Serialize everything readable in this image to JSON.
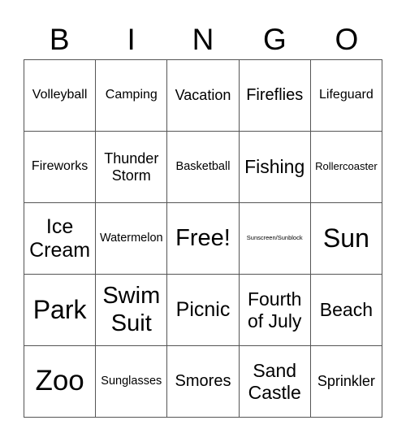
{
  "header": [
    "B",
    "I",
    "N",
    "G",
    "O"
  ],
  "cells": [
    [
      "Volleyball",
      "Camping",
      "Vacation",
      "Fireflies",
      "Lifeguard"
    ],
    [
      "Fireworks",
      "Thunder Storm",
      "Basketball",
      "Fishing",
      "Rollercoaster"
    ],
    [
      "Ice Cream",
      "Watermelon",
      "Free!",
      "Sunscreen/Sunblock",
      "Sun"
    ],
    [
      "Park",
      "Swim Suit",
      "Picnic",
      "Fourth of July",
      "Beach"
    ],
    [
      "Zoo",
      "Sunglasses",
      "Smores",
      "Sand Castle",
      "Sprinkler"
    ]
  ]
}
